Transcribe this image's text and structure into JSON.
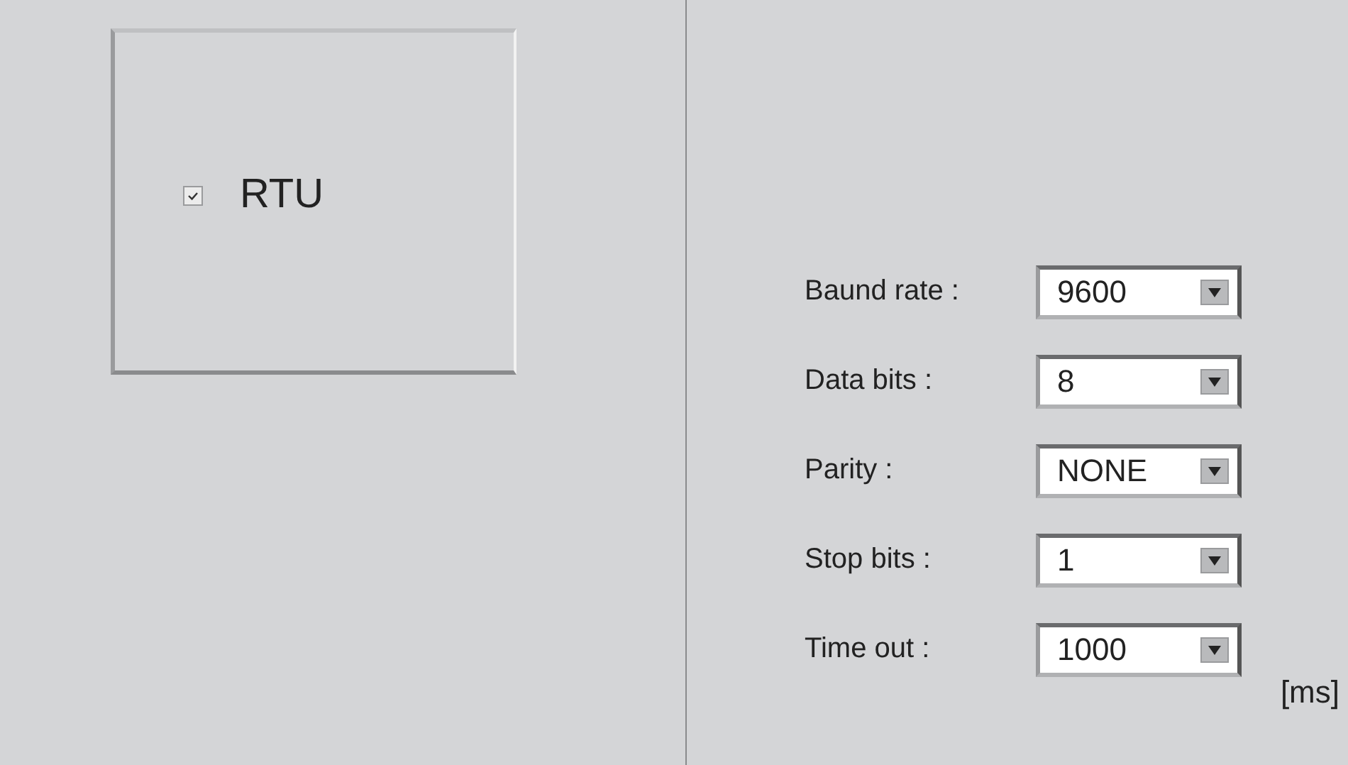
{
  "mode": {
    "label": "RTU",
    "checked": true
  },
  "settings": [
    {
      "label": "Baund rate :",
      "value": "9600"
    },
    {
      "label": "Data bits :",
      "value": "8"
    },
    {
      "label": "Parity :",
      "value": "NONE"
    },
    {
      "label": "Stop bits :",
      "value": "1"
    },
    {
      "label": "Time out :",
      "value": "1000"
    }
  ],
  "unit": "[ms]"
}
